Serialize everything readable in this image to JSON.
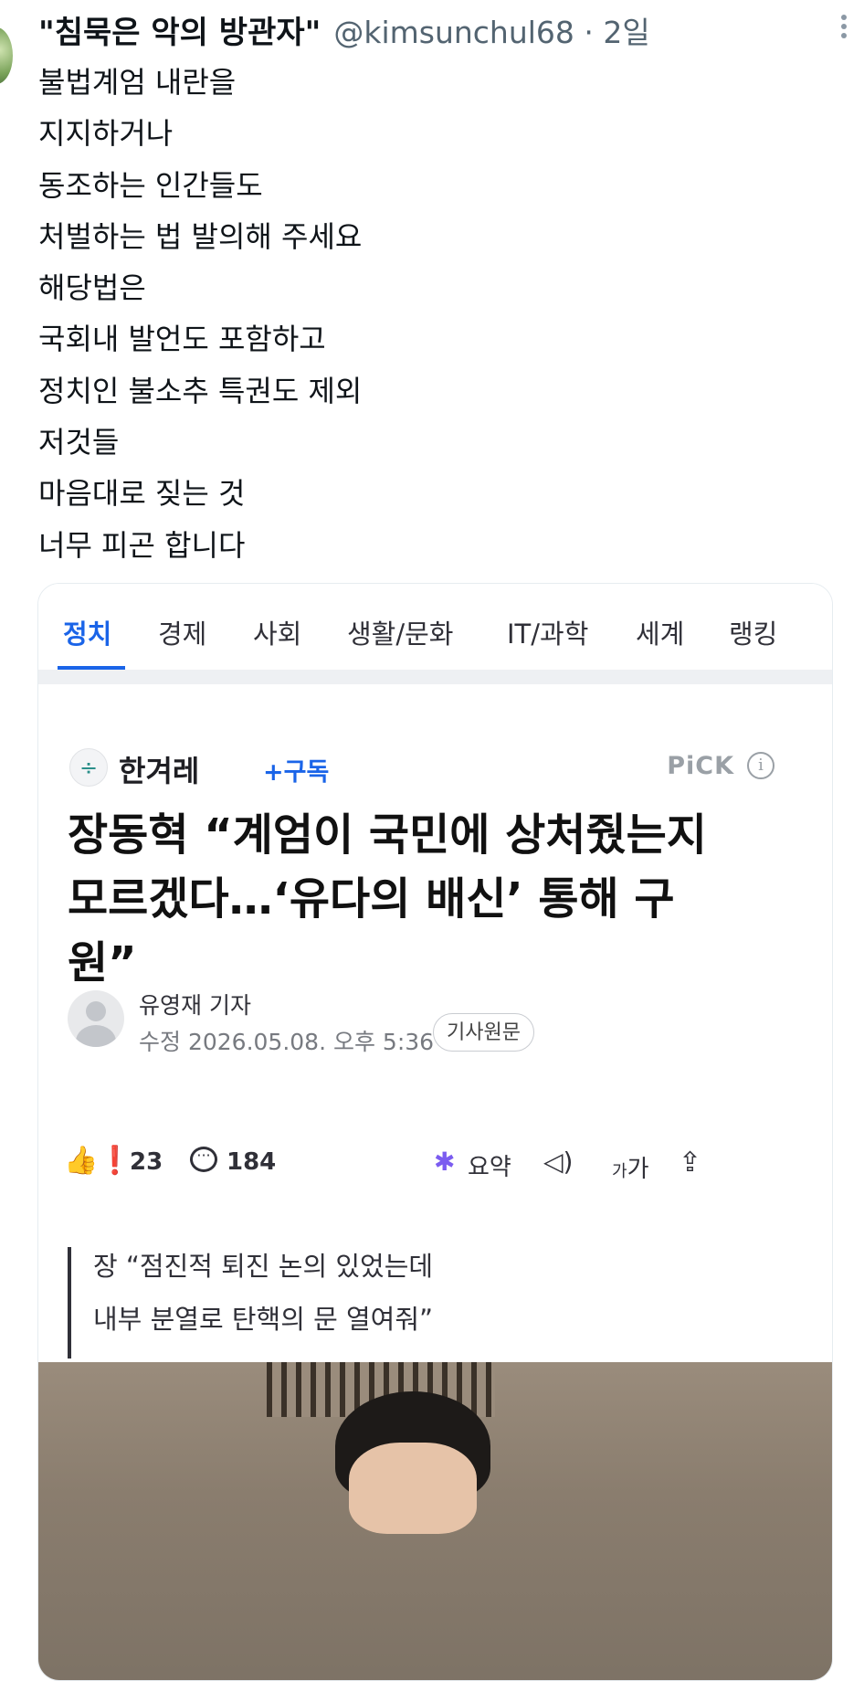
{
  "tweet": {
    "display_name": "\"침묵은 악의 방관자\"",
    "handle": "@kimsunchul68",
    "time": " · 2일",
    "lines": [
      "불법계엄 내란을",
      "지지하거나",
      "동조하는 인간들도",
      "처벌하는 법 발의해 주세요",
      "해당법은",
      "국회내 발언도 포함하고",
      "정치인 불소추 특권도 제외",
      "저것들",
      "마음대로 짖는 것",
      "너무 피곤 합니다"
    ]
  },
  "article": {
    "nav_tabs": [
      "정치",
      "경제",
      "사회",
      "생활/문화",
      "IT/과학",
      "세계",
      "랭킹"
    ],
    "active_tab": "정치",
    "press": {
      "name": "한겨레",
      "subscribe_label": "+구독",
      "pick_label": "PiCK",
      "logo_glyph": "÷"
    },
    "headline_lines": [
      "장동혁 “계엄이 국민에 상처줬는지",
      "모르겠다…‘유다의 배신’ 통해 구",
      "원”"
    ],
    "reporter": "유영재 기자",
    "datetime": "수정 2026.05.08. 오후 5:36",
    "original_label": "기사원문",
    "reactions": {
      "count": "23"
    },
    "comments": {
      "count": "184"
    },
    "summary_label": "요약",
    "font_size_label_small": "가",
    "font_size_label_large": "가",
    "quote_lines": [
      "장 “점진적 퇴진 논의 있었는데",
      "내부 분열로 탄핵의 문 열여줘”"
    ],
    "accent_color": "#1a64e8"
  }
}
